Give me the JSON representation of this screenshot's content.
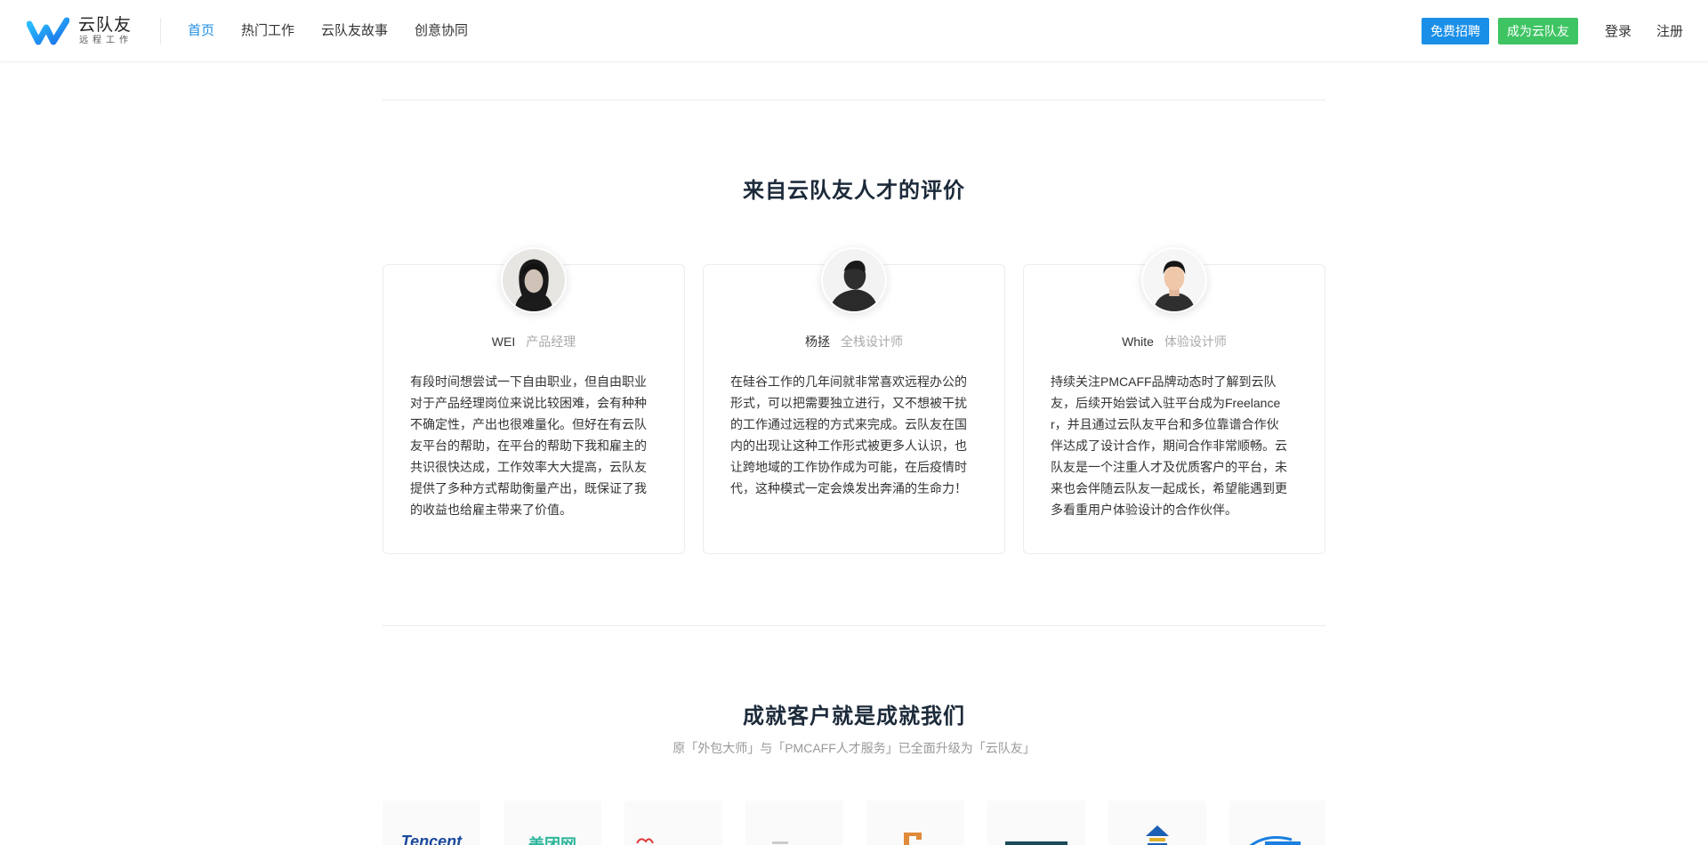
{
  "brand": {
    "name": "云队友",
    "tagline": "远程工作",
    "colors": {
      "primary": "#1a8fe8",
      "success": "#3fc463",
      "nav_active": "#1f8fe6"
    }
  },
  "nav": {
    "items": [
      {
        "label": "首页",
        "active": true
      },
      {
        "label": "热门工作",
        "active": false
      },
      {
        "label": "云队友故事",
        "active": false
      },
      {
        "label": "创意协同",
        "active": false
      }
    ]
  },
  "actions": {
    "hire_label": "免费招聘",
    "join_label": "成为云队友",
    "login_label": "登录",
    "register_label": "注册"
  },
  "testimonials": {
    "title": "来自云队友人才的评价",
    "cards": [
      {
        "name": "WEI",
        "role": "产品经理",
        "text": "有段时间想尝试一下自由职业，但自由职业对于产品经理岗位来说比较困难，会有种种不确定性，产出也很难量化。但好在有云队友平台的帮助，在平台的帮助下我和雇主的共识很快达成，工作效率大大提高，云队友提供了多种方式帮助衡量产出，既保证了我的收益也给雇主带来了价值。"
      },
      {
        "name": "杨拯",
        "role": "全栈设计师",
        "text": "在硅谷工作的几年间就非常喜欢远程办公的形式，可以把需要独立进行，又不想被干扰的工作通过远程的方式来完成。云队友在国内的出现让这种工作形式被更多人认识，也让跨地域的工作协作成为可能，在后疫情时代，这种模式一定会焕发出奔涌的生命力！"
      },
      {
        "name": "White",
        "role": "体验设计师",
        "text": "持续关注PMCAFF品牌动态时了解到云队友，后续开始尝试入驻平台成为Freelancer，并且通过云队友平台和多位靠谱合作伙伴达成了设计合作，期间合作非常顺畅。云队友是一个注重人才及优质客户的平台，未来也会伴随云队友一起成长，希望能遇到更多看重用户体验设计的合作伙伴。"
      }
    ]
  },
  "clients": {
    "title": "成就客户就是成就我们",
    "subtitle": "原「外包大师」与「PMCAFF人才服务」已全面升级为「云队友」",
    "logos": [
      {
        "icon": "tencent-logo",
        "text": "Tencent",
        "color": "#1a4a9c"
      },
      {
        "icon": "meituan-logo",
        "text": "美团网",
        "color": "#2bb59b"
      },
      {
        "icon": "client-logo-3",
        "text": "",
        "color": "#e03a3a"
      },
      {
        "icon": "client-logo-4",
        "text": "",
        "color": "#cccccc"
      },
      {
        "icon": "client-logo-5",
        "text": "",
        "color": "#e08a3a"
      },
      {
        "icon": "client-logo-6",
        "text": "",
        "color": "#1c4a5a"
      },
      {
        "icon": "client-logo-7",
        "text": "",
        "color": "#1a5fb4"
      },
      {
        "icon": "ctrip-logo",
        "text": "",
        "color": "#1a7fe0"
      }
    ]
  }
}
